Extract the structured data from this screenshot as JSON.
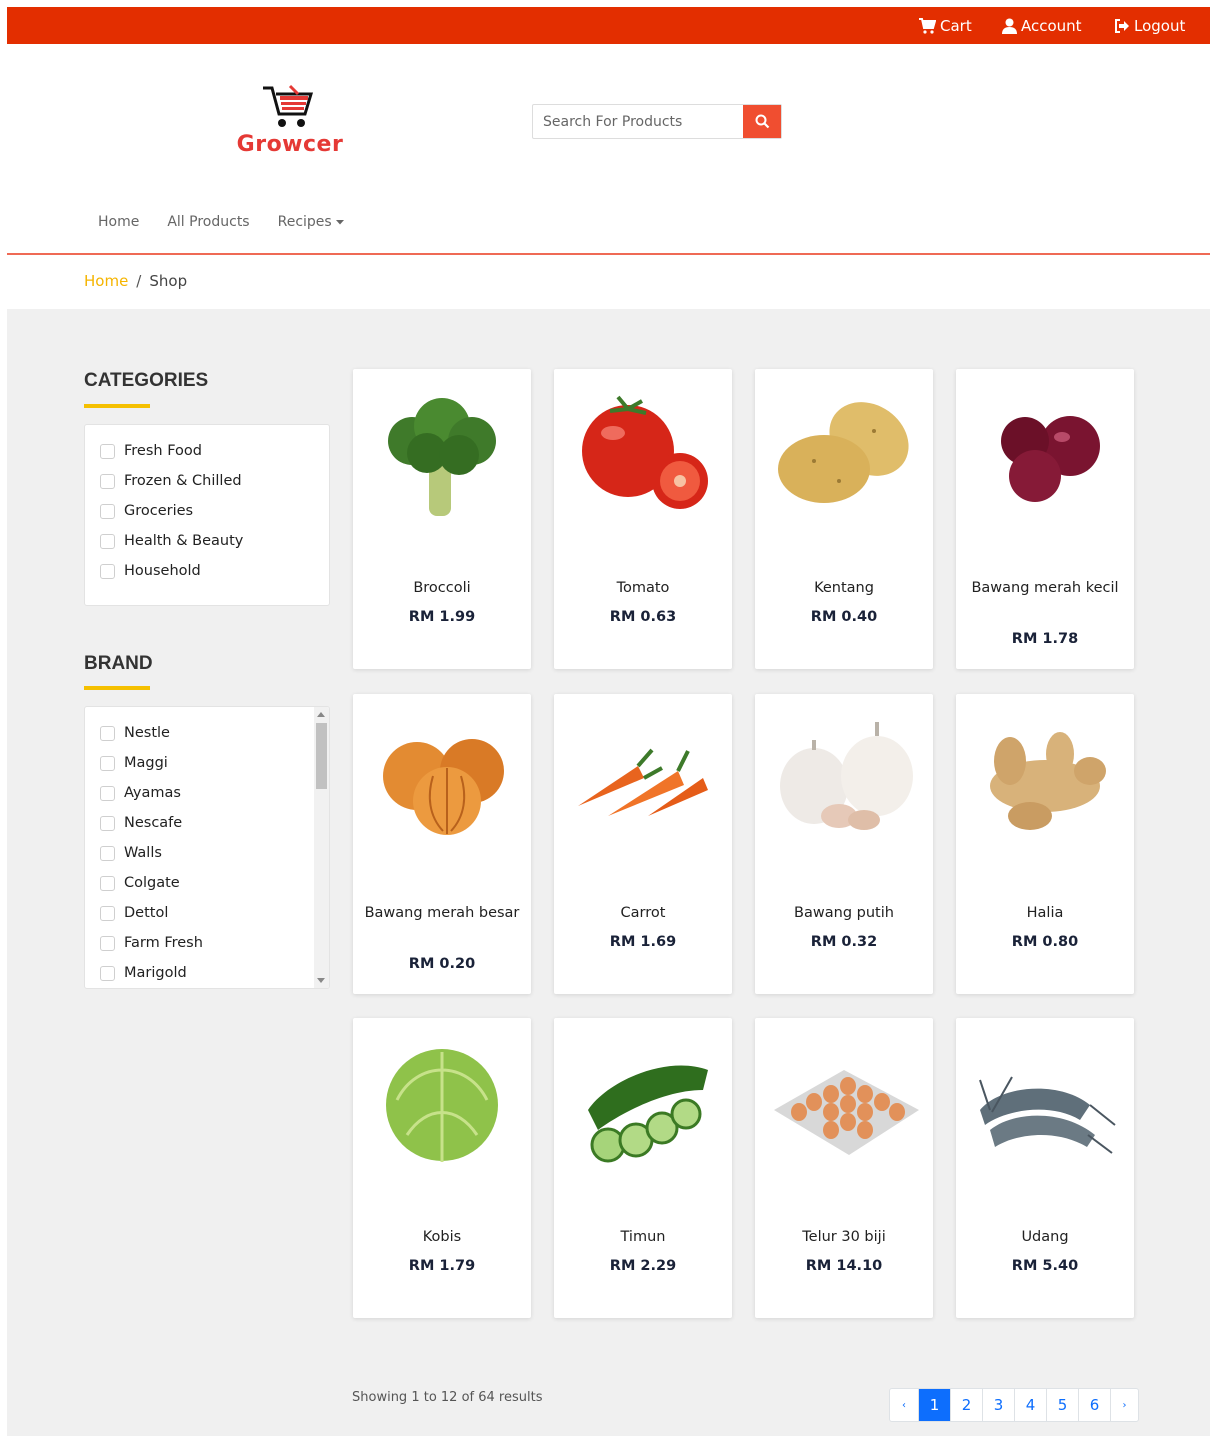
{
  "topbar": {
    "cart_label": "Cart",
    "account_label": "Account",
    "logout_label": "Logout",
    "color": "#e32e00"
  },
  "brand": {
    "name": "Growcer",
    "color": "#e53935"
  },
  "search": {
    "placeholder": "Search For Products",
    "value": ""
  },
  "nav": {
    "home": "Home",
    "all_products": "All Products",
    "recipes": "Recipes"
  },
  "breadcrumb": {
    "home": "Home",
    "separator": "/",
    "current": "Shop"
  },
  "sidebar": {
    "categories_title": "CATEGORIES",
    "categories": [
      "Fresh Food",
      "Frozen & Chilled",
      "Groceries",
      "Health & Beauty",
      "Household"
    ],
    "brand_title": "BRAND",
    "brands": [
      "Nestle",
      "Maggi",
      "Ayamas",
      "Nescafe",
      "Walls",
      "Colgate",
      "Dettol",
      "Farm Fresh",
      "Marigold"
    ]
  },
  "products": [
    {
      "name": "Broccoli",
      "price": "RM 1.99",
      "icon": "broccoli"
    },
    {
      "name": "Tomato",
      "price": "RM 0.63",
      "icon": "tomato"
    },
    {
      "name": "Kentang",
      "price": "RM 0.40",
      "icon": "potato"
    },
    {
      "name": "Bawang merah kecil",
      "price": "RM 1.78",
      "icon": "red-onion"
    },
    {
      "name": "Bawang merah besar",
      "price": "RM 0.20",
      "icon": "onion"
    },
    {
      "name": "Carrot",
      "price": "RM 1.69",
      "icon": "carrot"
    },
    {
      "name": "Bawang putih",
      "price": "RM 0.32",
      "icon": "garlic"
    },
    {
      "name": "Halia",
      "price": "RM 0.80",
      "icon": "ginger"
    },
    {
      "name": "Kobis",
      "price": "RM 1.79",
      "icon": "cabbage"
    },
    {
      "name": "Timun",
      "price": "RM 2.29",
      "icon": "cucumber"
    },
    {
      "name": "Telur 30 biji",
      "price": "RM 14.10",
      "icon": "eggs"
    },
    {
      "name": "Udang",
      "price": "RM 5.40",
      "icon": "prawn"
    }
  ],
  "results_text": "Showing 1 to 12 of 64 results",
  "pagination": {
    "prev": "‹",
    "pages": [
      "1",
      "2",
      "3",
      "4",
      "5",
      "6"
    ],
    "next": "›",
    "active": "1"
  },
  "accent": "#f5c000",
  "link_color": "#0d6efd"
}
